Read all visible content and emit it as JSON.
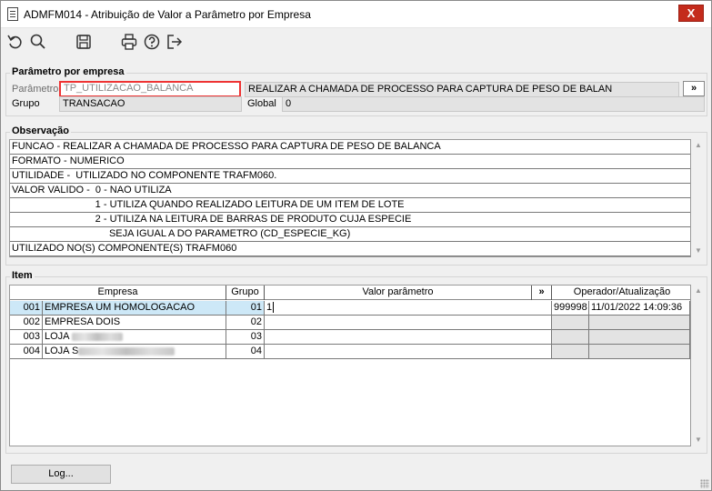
{
  "window": {
    "title": "ADMFM014 - Atribuição de Valor a Parâmetro por Empresa",
    "close_label": "X"
  },
  "toolbar": {
    "icons": [
      "undo-icon",
      "search-icon",
      "save-icon",
      "print-icon",
      "help-icon",
      "exit-icon"
    ]
  },
  "param_group": {
    "legend": "Parâmetro por empresa",
    "parametro_label": "Parâmetro",
    "parametro_value": "TP_UTILIZACAO_BALANCA",
    "descricao_value": "REALIZAR A CHAMADA DE PROCESSO PARA CAPTURA DE PESO DE BALAN",
    "more_label": "»",
    "grupo_label": "Grupo",
    "grupo_value": "TRANSACAO",
    "global_label": "Global",
    "global_value": "0"
  },
  "observacao": {
    "legend": "Observação",
    "lines": [
      "FUNCAO - REALIZAR A CHAMADA DE PROCESSO PARA CAPTURA DE PESO DE BALANCA",
      "FORMATO - NUMERICO",
      "UTILIDADE -  UTILIZADO NO COMPONENTE TRAFM060.",
      "VALOR VALIDO -  0 - NAO UTILIZA",
      "                              1 - UTILIZA QUANDO REALIZADO LEITURA DE UM ITEM DE LOTE",
      "                              2 - UTILIZA NA LEITURA DE BARRAS DE PRODUTO CUJA ESPECIE",
      "                                   SEJA IGUAL A DO PARAMETRO (CD_ESPECIE_KG)",
      "UTILIZADO NO(S) COMPONENTE(S) TRAFM060"
    ]
  },
  "item": {
    "legend": "Item",
    "columns": {
      "empresa": "Empresa",
      "grupo": "Grupo",
      "valor": "Valor parâmetro",
      "valor_more": "»",
      "operador": "Operador/Atualização"
    },
    "rows": [
      {
        "codigo": "001",
        "empresa": "EMPRESA UM HOMOLOGACAO",
        "grupo": "01",
        "valor": "1",
        "operador": "999998",
        "atualizacao": "11/01/2022 14:09:36"
      },
      {
        "codigo": "002",
        "empresa": "EMPRESA DOIS",
        "grupo": "02",
        "valor": "",
        "operador": "",
        "atualizacao": ""
      },
      {
        "codigo": "003",
        "empresa": "LOJA",
        "grupo": "03",
        "valor": "",
        "operador": "",
        "atualizacao": ""
      },
      {
        "codigo": "004",
        "empresa": "LOJA S",
        "grupo": "04",
        "valor": "",
        "operador": "",
        "atualizacao": ""
      }
    ]
  },
  "footer": {
    "log_label": "Log..."
  }
}
